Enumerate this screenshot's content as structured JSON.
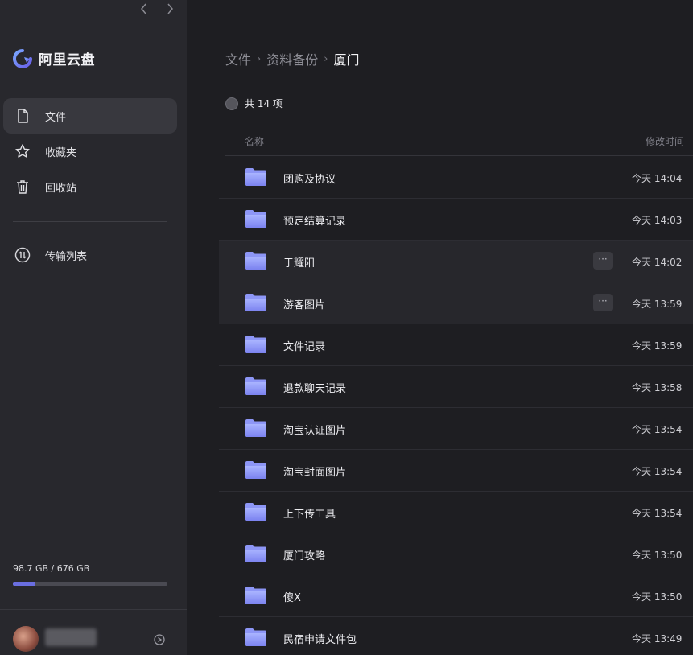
{
  "app": {
    "name": "阿里云盘",
    "accent": "#6a6ee0"
  },
  "sidebar": {
    "items": [
      {
        "label": "文件",
        "icon": "file-icon",
        "active": true
      },
      {
        "label": "收藏夹",
        "icon": "star-icon",
        "active": false
      },
      {
        "label": "回收站",
        "icon": "trash-icon",
        "active": false
      }
    ],
    "transfer": {
      "label": "传输列表",
      "icon": "transfer-icon"
    },
    "storage": {
      "text": "98.7 GB / 676 GB",
      "used_fraction": 0.146
    }
  },
  "breadcrumb": {
    "items": [
      "文件",
      "资料备份"
    ],
    "current": "厦门",
    "separator": "›"
  },
  "list": {
    "count_label": "共 14 项",
    "header": {
      "name": "名称",
      "time": "修改时间"
    },
    "more_label": "···",
    "rows": [
      {
        "name": "团购及协议",
        "time": "今天 14:04",
        "hover": false
      },
      {
        "name": "预定结算记录",
        "time": "今天 14:03",
        "hover": false
      },
      {
        "name": "于耀阳",
        "time": "今天 14:02",
        "hover": true
      },
      {
        "name": "游客图片",
        "time": "今天 13:59",
        "hover": true
      },
      {
        "name": "文件记录",
        "time": "今天 13:59",
        "hover": false
      },
      {
        "name": "退款聊天记录",
        "time": "今天 13:58",
        "hover": false
      },
      {
        "name": "淘宝认证图片",
        "time": "今天 13:54",
        "hover": false
      },
      {
        "name": "淘宝封面图片",
        "time": "今天 13:54",
        "hover": false
      },
      {
        "name": "上下传工具",
        "time": "今天 13:54",
        "hover": false
      },
      {
        "name": "厦门攻略",
        "time": "今天 13:50",
        "hover": false
      },
      {
        "name": "傻X",
        "time": "今天 13:50",
        "hover": false
      },
      {
        "name": "民宿申请文件包",
        "time": "今天 13:49",
        "hover": false
      }
    ]
  }
}
